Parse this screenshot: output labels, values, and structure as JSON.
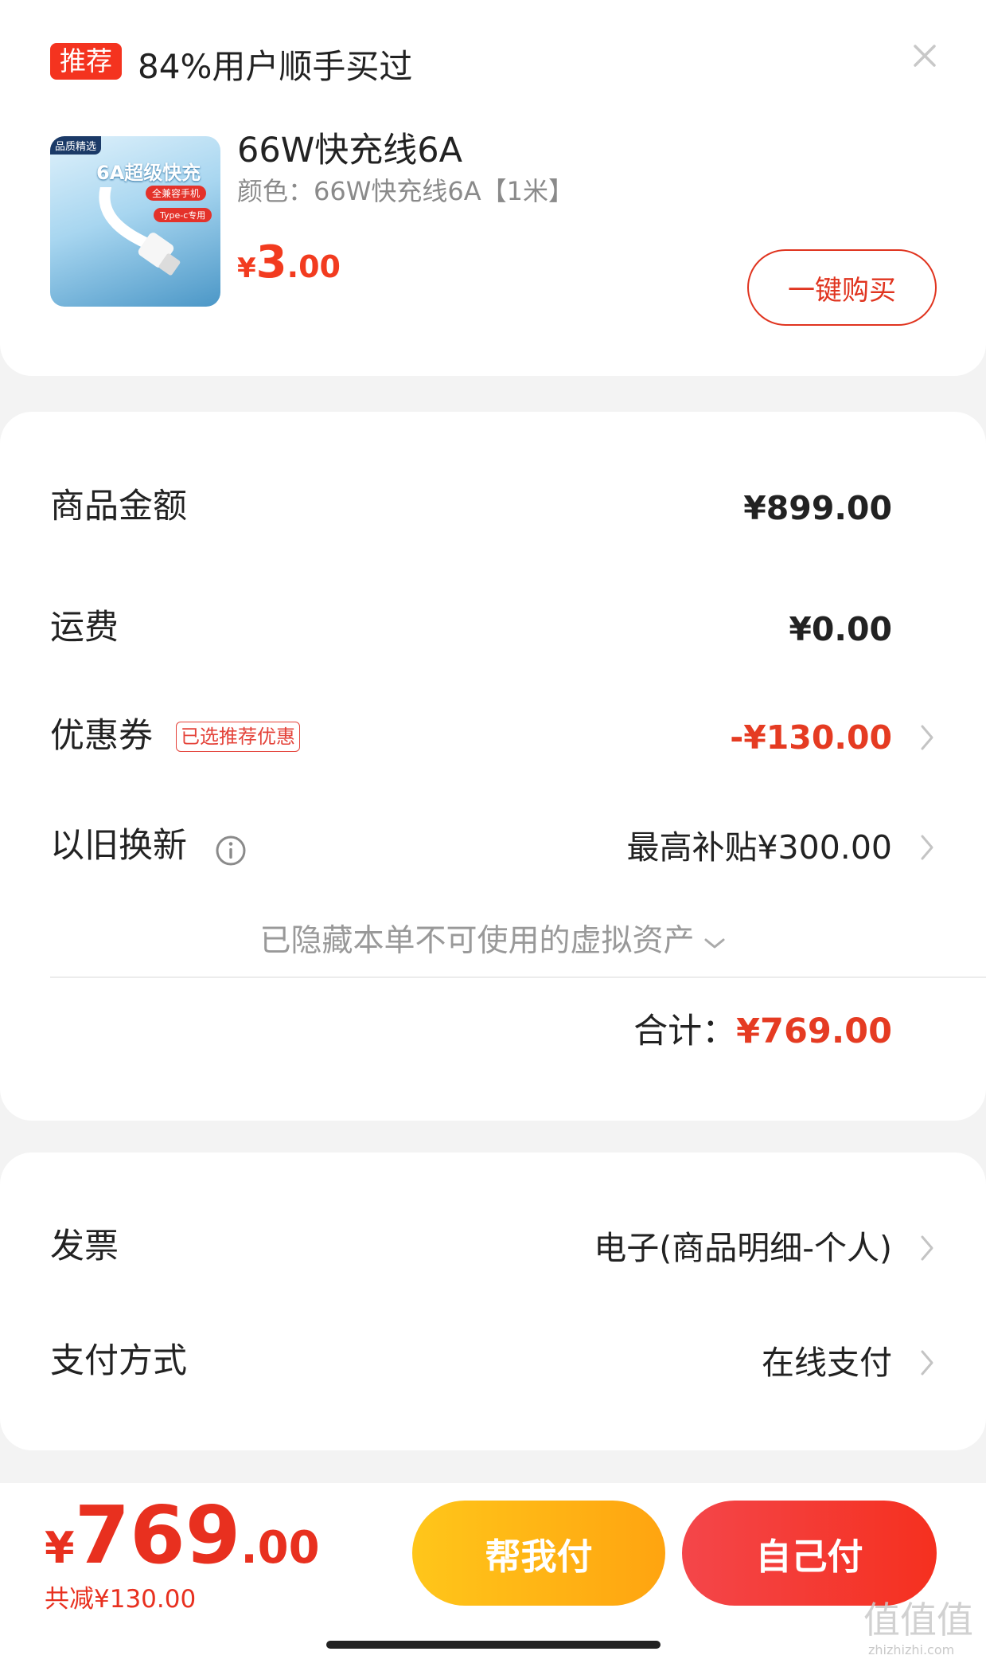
{
  "recommend": {
    "tag": "推荐",
    "headline": "84%用户顺手买过",
    "close_icon": "close-icon",
    "product": {
      "image_texts": {
        "badge": "品质精选",
        "title": "6A超级快充",
        "pill1": "全兼容手机",
        "pill2": "Type-c专用"
      },
      "name": "66W快充线6A",
      "spec": "颜色：66W快充线6A【1米】",
      "price_symbol": "¥",
      "price_int": "3",
      "price_dec": ".00"
    },
    "buy_button": "一键购买"
  },
  "amounts": {
    "goods": {
      "label": "商品金额",
      "value": "¥899.00"
    },
    "shipping": {
      "label": "运费",
      "value": "¥0.00"
    },
    "coupon": {
      "label": "优惠券",
      "tag": "已选推荐优惠",
      "value": "-¥130.00"
    },
    "tradein": {
      "label": "以旧换新",
      "value": "最高补贴¥300.00",
      "icon": "info-icon"
    },
    "hidden_assets": "已隐藏本单不可使用的虚拟资产",
    "total_label": "合计：",
    "total_value": "¥769.00"
  },
  "payment": {
    "invoice": {
      "label": "发票",
      "value": "电子(商品明细-个人)"
    },
    "method": {
      "label": "支付方式",
      "value": "在线支付"
    }
  },
  "bottom": {
    "price_symbol": "¥",
    "price_int": "769",
    "price_dec": ".00",
    "saved": "共减¥130.00",
    "help_pay": "帮我付",
    "self_pay": "自己付"
  },
  "watermark": {
    "main": "值值值",
    "sub": "zhizhizhi.com"
  },
  "colors": {
    "accent_red": "#e53b22",
    "help_button": "#ffb416",
    "self_button": "#f33a30"
  }
}
